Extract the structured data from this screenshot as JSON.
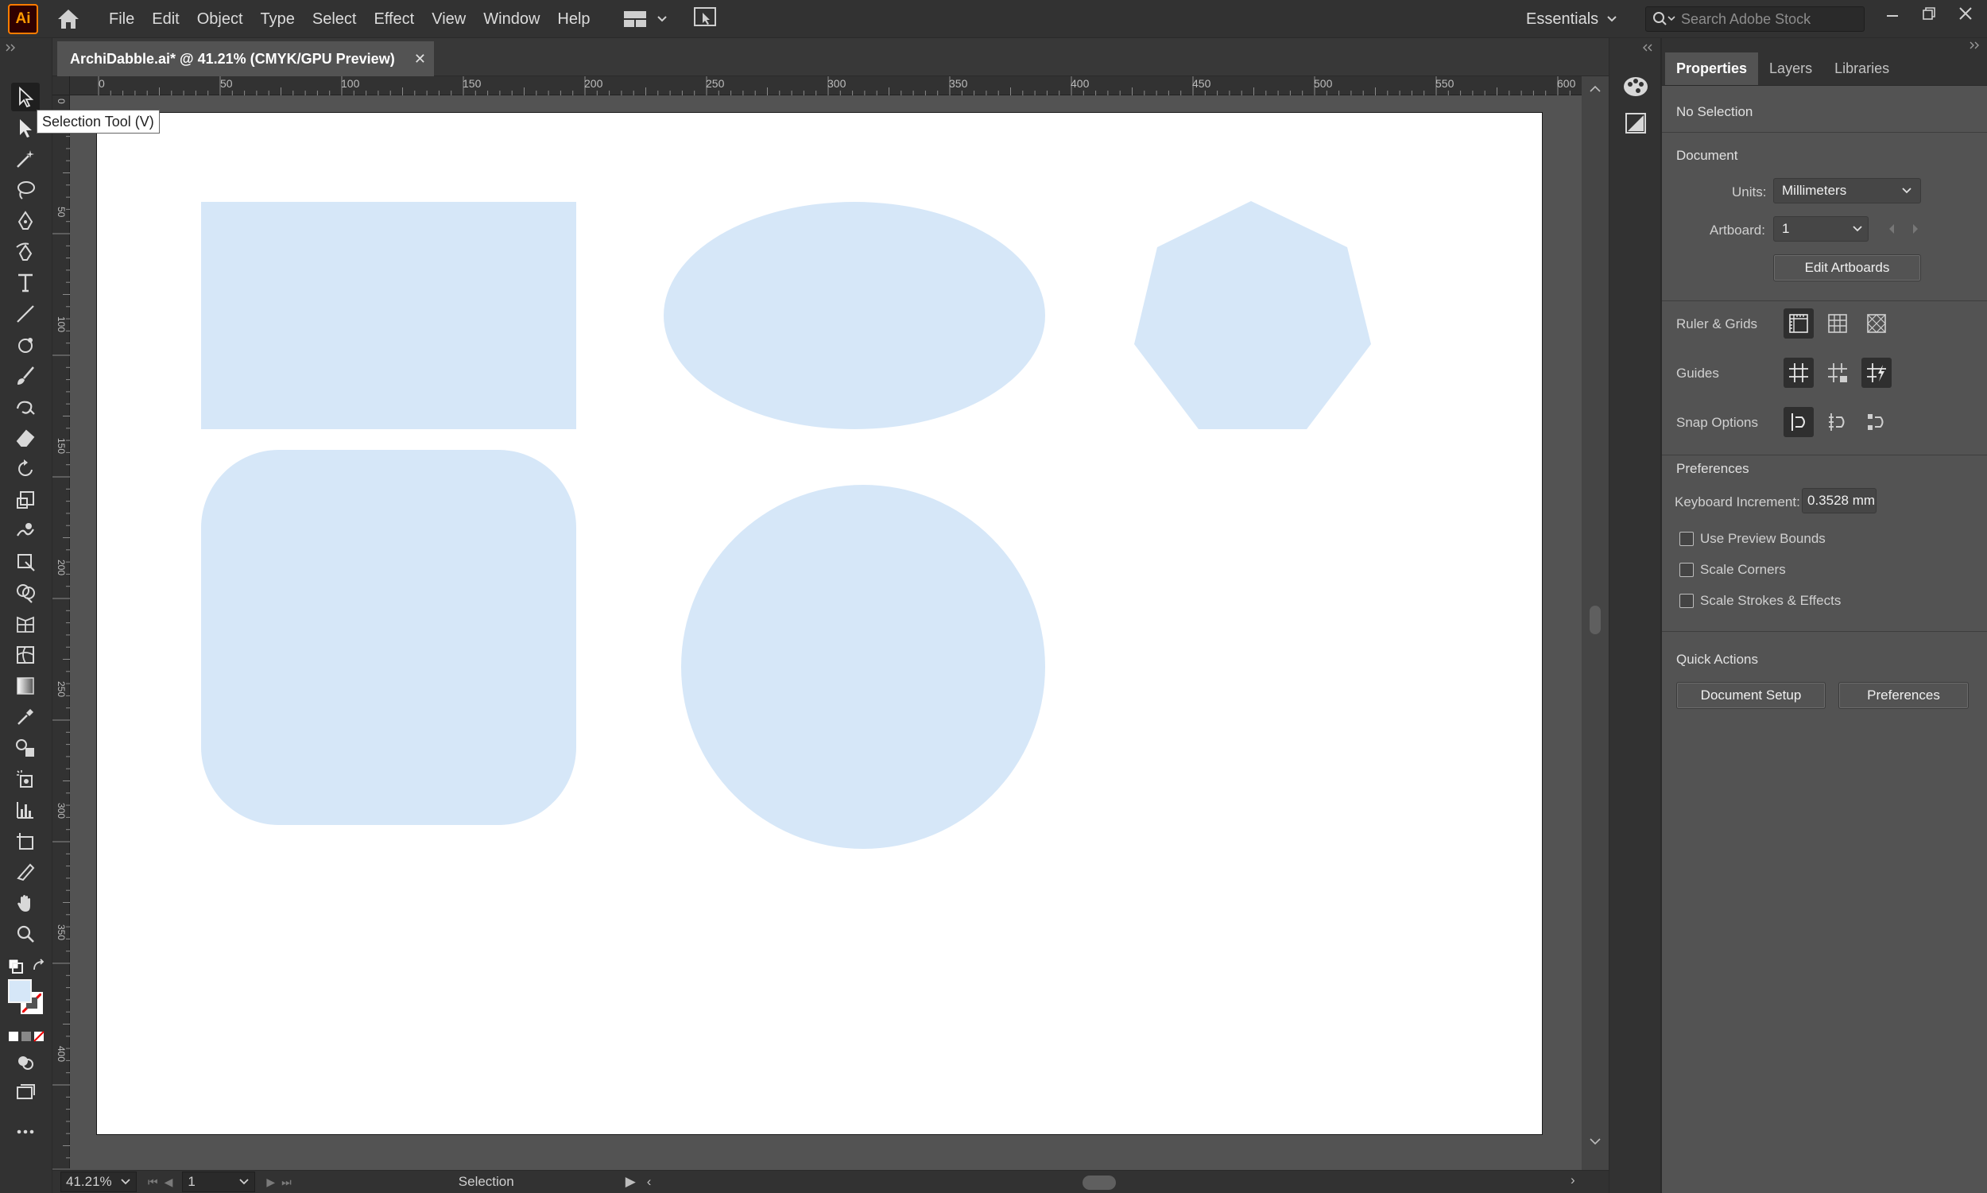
{
  "menubar": {
    "app_logo": "Ai",
    "items": [
      "File",
      "Edit",
      "Object",
      "Type",
      "Select",
      "Effect",
      "View",
      "Window",
      "Help"
    ],
    "workspace": "Essentials",
    "search_placeholder": "Search Adobe Stock"
  },
  "document": {
    "tab_title": "ArchiDabble.ai* @ 41.21% (CMYK/GPU Preview)",
    "tab_close": "✕"
  },
  "ruler": {
    "top_ticks": [
      "0",
      "50",
      "100",
      "150",
      "200",
      "250",
      "300",
      "350",
      "400",
      "450",
      "500",
      "550",
      "600"
    ],
    "left_ticks": [
      "0",
      "50",
      "100",
      "150",
      "200",
      "250",
      "300",
      "350",
      "400"
    ]
  },
  "tooltip": "Selection Tool (V)",
  "statusbar": {
    "zoom": "41.21%",
    "artboard": "1",
    "status": "Selection"
  },
  "panel": {
    "tabs": [
      "Properties",
      "Layers",
      "Libraries"
    ],
    "selection_state": "No Selection",
    "document_title": "Document",
    "units_label": "Units:",
    "units_value": "Millimeters",
    "artboard_label": "Artboard:",
    "artboard_value": "1",
    "edit_artboards": "Edit Artboards",
    "ruler_grids": "Ruler & Grids",
    "guides": "Guides",
    "snap_options": "Snap Options",
    "preferences_title": "Preferences",
    "keyboard_increment_label": "Keyboard Increment:",
    "keyboard_increment_value": "0.3528 mm",
    "checkboxes": [
      "Use Preview Bounds",
      "Scale Corners",
      "Scale Strokes & Effects"
    ],
    "quick_actions": "Quick Actions",
    "document_setup": "Document Setup",
    "preferences_btn": "Preferences"
  },
  "colors": {
    "shape_fill": "#d6e7f8",
    "ui_dark": "#323232",
    "ui_mid": "#535353"
  }
}
